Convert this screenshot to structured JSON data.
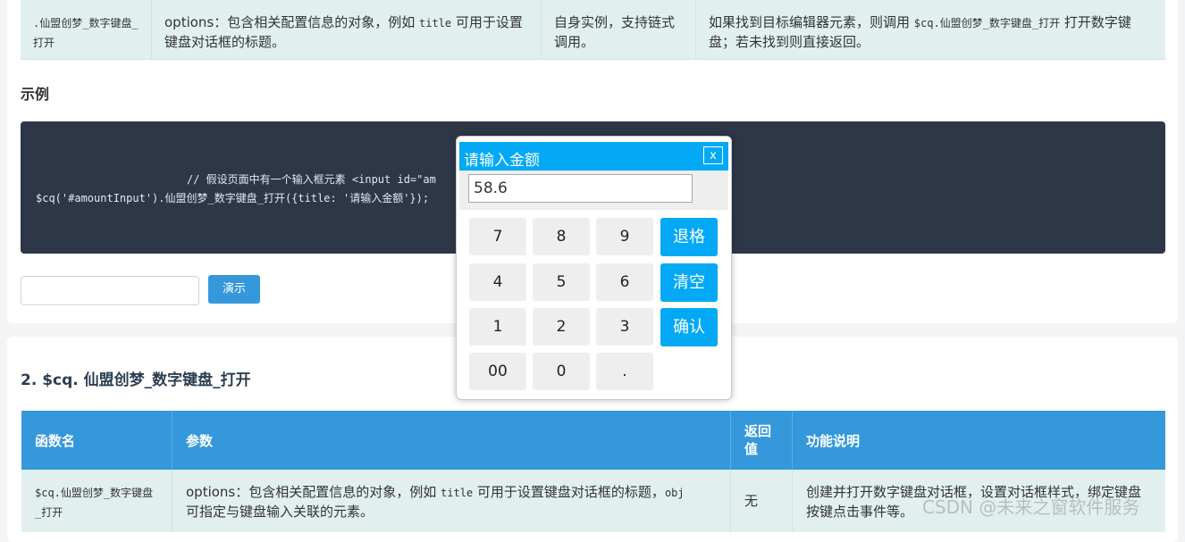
{
  "top_row": {
    "c1": ".仙盟创梦_数字键盘_打开",
    "c2_a": "options：包含相关配置信息的对象，例如 ",
    "c2_code": "title",
    "c2_b": " 可用于设置键盘对话框的标题。",
    "c3": "自身实例，支持链式调用。",
    "c4_a": "如果找到目标编辑器元素，则调用 ",
    "c4_code": "$cq.仙盟创梦_数字键盘_打开",
    "c4_b": " 打开数字键盘；若未找到则直接返回。"
  },
  "example": {
    "title": "示例",
    "code_line1": "// 假设页面中有一个输入框元素 <input id=\"am",
    "code_line2": "$cq('#amountInput').仙盟创梦_数字键盘_打开({title: '请输入金额'});",
    "demo_button": "演示"
  },
  "section2": {
    "heading": "2. $cq. 仙盟创梦_数字键盘_打开",
    "headers": [
      "函数名",
      "参数",
      "返回值",
      "功能说明"
    ],
    "row": {
      "c1": "$cq.仙盟创梦_数字键盘_打开",
      "c2_a": "options：包含相关配置信息的对象，例如 ",
      "c2_code1": "title",
      "c2_b": " 可用于设置键盘对话框的标题，",
      "c2_code2": "obj",
      "c2_c": "可指定与键盘输入关联的元素。",
      "c3": "无",
      "c4": "创建并打开数字键盘对话框，设置对话框样式，绑定键盘按键点击事件等。"
    }
  },
  "watermark": "CSDN @未来之窗软件服务",
  "keypad": {
    "title": "请输入金额",
    "close": "x",
    "value": "58.6",
    "keys": [
      "7",
      "8",
      "9",
      "4",
      "5",
      "6",
      "1",
      "2",
      "3",
      "00",
      "0",
      "."
    ],
    "backspace": "退格",
    "clear": "清空",
    "confirm": "确认"
  },
  "colors": {
    "header_blue": "#3498db",
    "keypad_blue": "#03a9f4",
    "code_bg": "#2d3748"
  }
}
